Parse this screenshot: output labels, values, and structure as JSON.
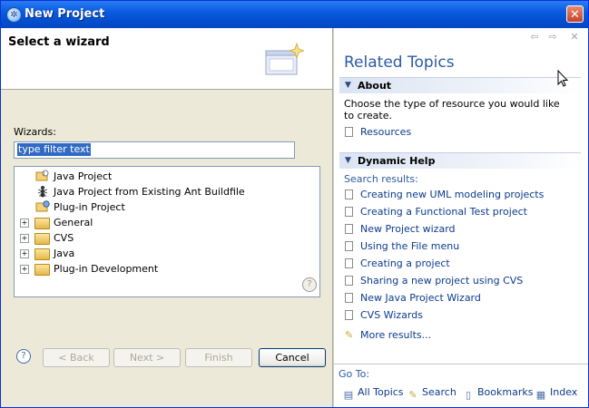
{
  "window": {
    "title": "New Project"
  },
  "left": {
    "banner_title": "Select a wizard",
    "wizards_label": "Wizards:",
    "filter_value": "type filter text",
    "tree": [
      {
        "label": "Java Project",
        "icon": "java-project-icon",
        "level": 1,
        "expandable": false
      },
      {
        "label": "Java Project from Existing Ant Buildfile",
        "icon": "ant-icon",
        "level": 1,
        "expandable": false
      },
      {
        "label": "Plug-in Project",
        "icon": "plugin-project-icon",
        "level": 1,
        "expandable": false
      },
      {
        "label": "General",
        "icon": "folder-icon",
        "level": 0,
        "expandable": true
      },
      {
        "label": "CVS",
        "icon": "folder-icon",
        "level": 0,
        "expandable": true
      },
      {
        "label": "Java",
        "icon": "folder-icon",
        "level": 0,
        "expandable": true
      },
      {
        "label": "Plug-in Development",
        "icon": "folder-icon",
        "level": 0,
        "expandable": true
      }
    ]
  },
  "buttons": {
    "back": "< Back",
    "next": "Next >",
    "finish": "Finish",
    "cancel": "Cancel"
  },
  "help": {
    "title": "Related Topics",
    "about": {
      "heading": "About",
      "text": "Choose the type of resource you would like to create.",
      "links": [
        "Resources"
      ]
    },
    "dynamic": {
      "heading": "Dynamic Help",
      "search_results_label": "Search results:",
      "links": [
        "Creating new UML modeling projects",
        "Creating a Functional Test project",
        "New Project wizard",
        "Using the File menu",
        "Creating a project",
        "Sharing a new project using CVS",
        "New Java Project Wizard",
        "CVS Wizards"
      ],
      "more": "More results..."
    },
    "goto": {
      "label": "Go To:",
      "items": [
        "All Topics",
        "Search",
        "Bookmarks",
        "Index"
      ]
    }
  },
  "colors": {
    "title_bar": "#0a5be0",
    "link": "#0b3b8c",
    "heading_blue": "#2c5aa0",
    "selection": "#316ac5"
  }
}
